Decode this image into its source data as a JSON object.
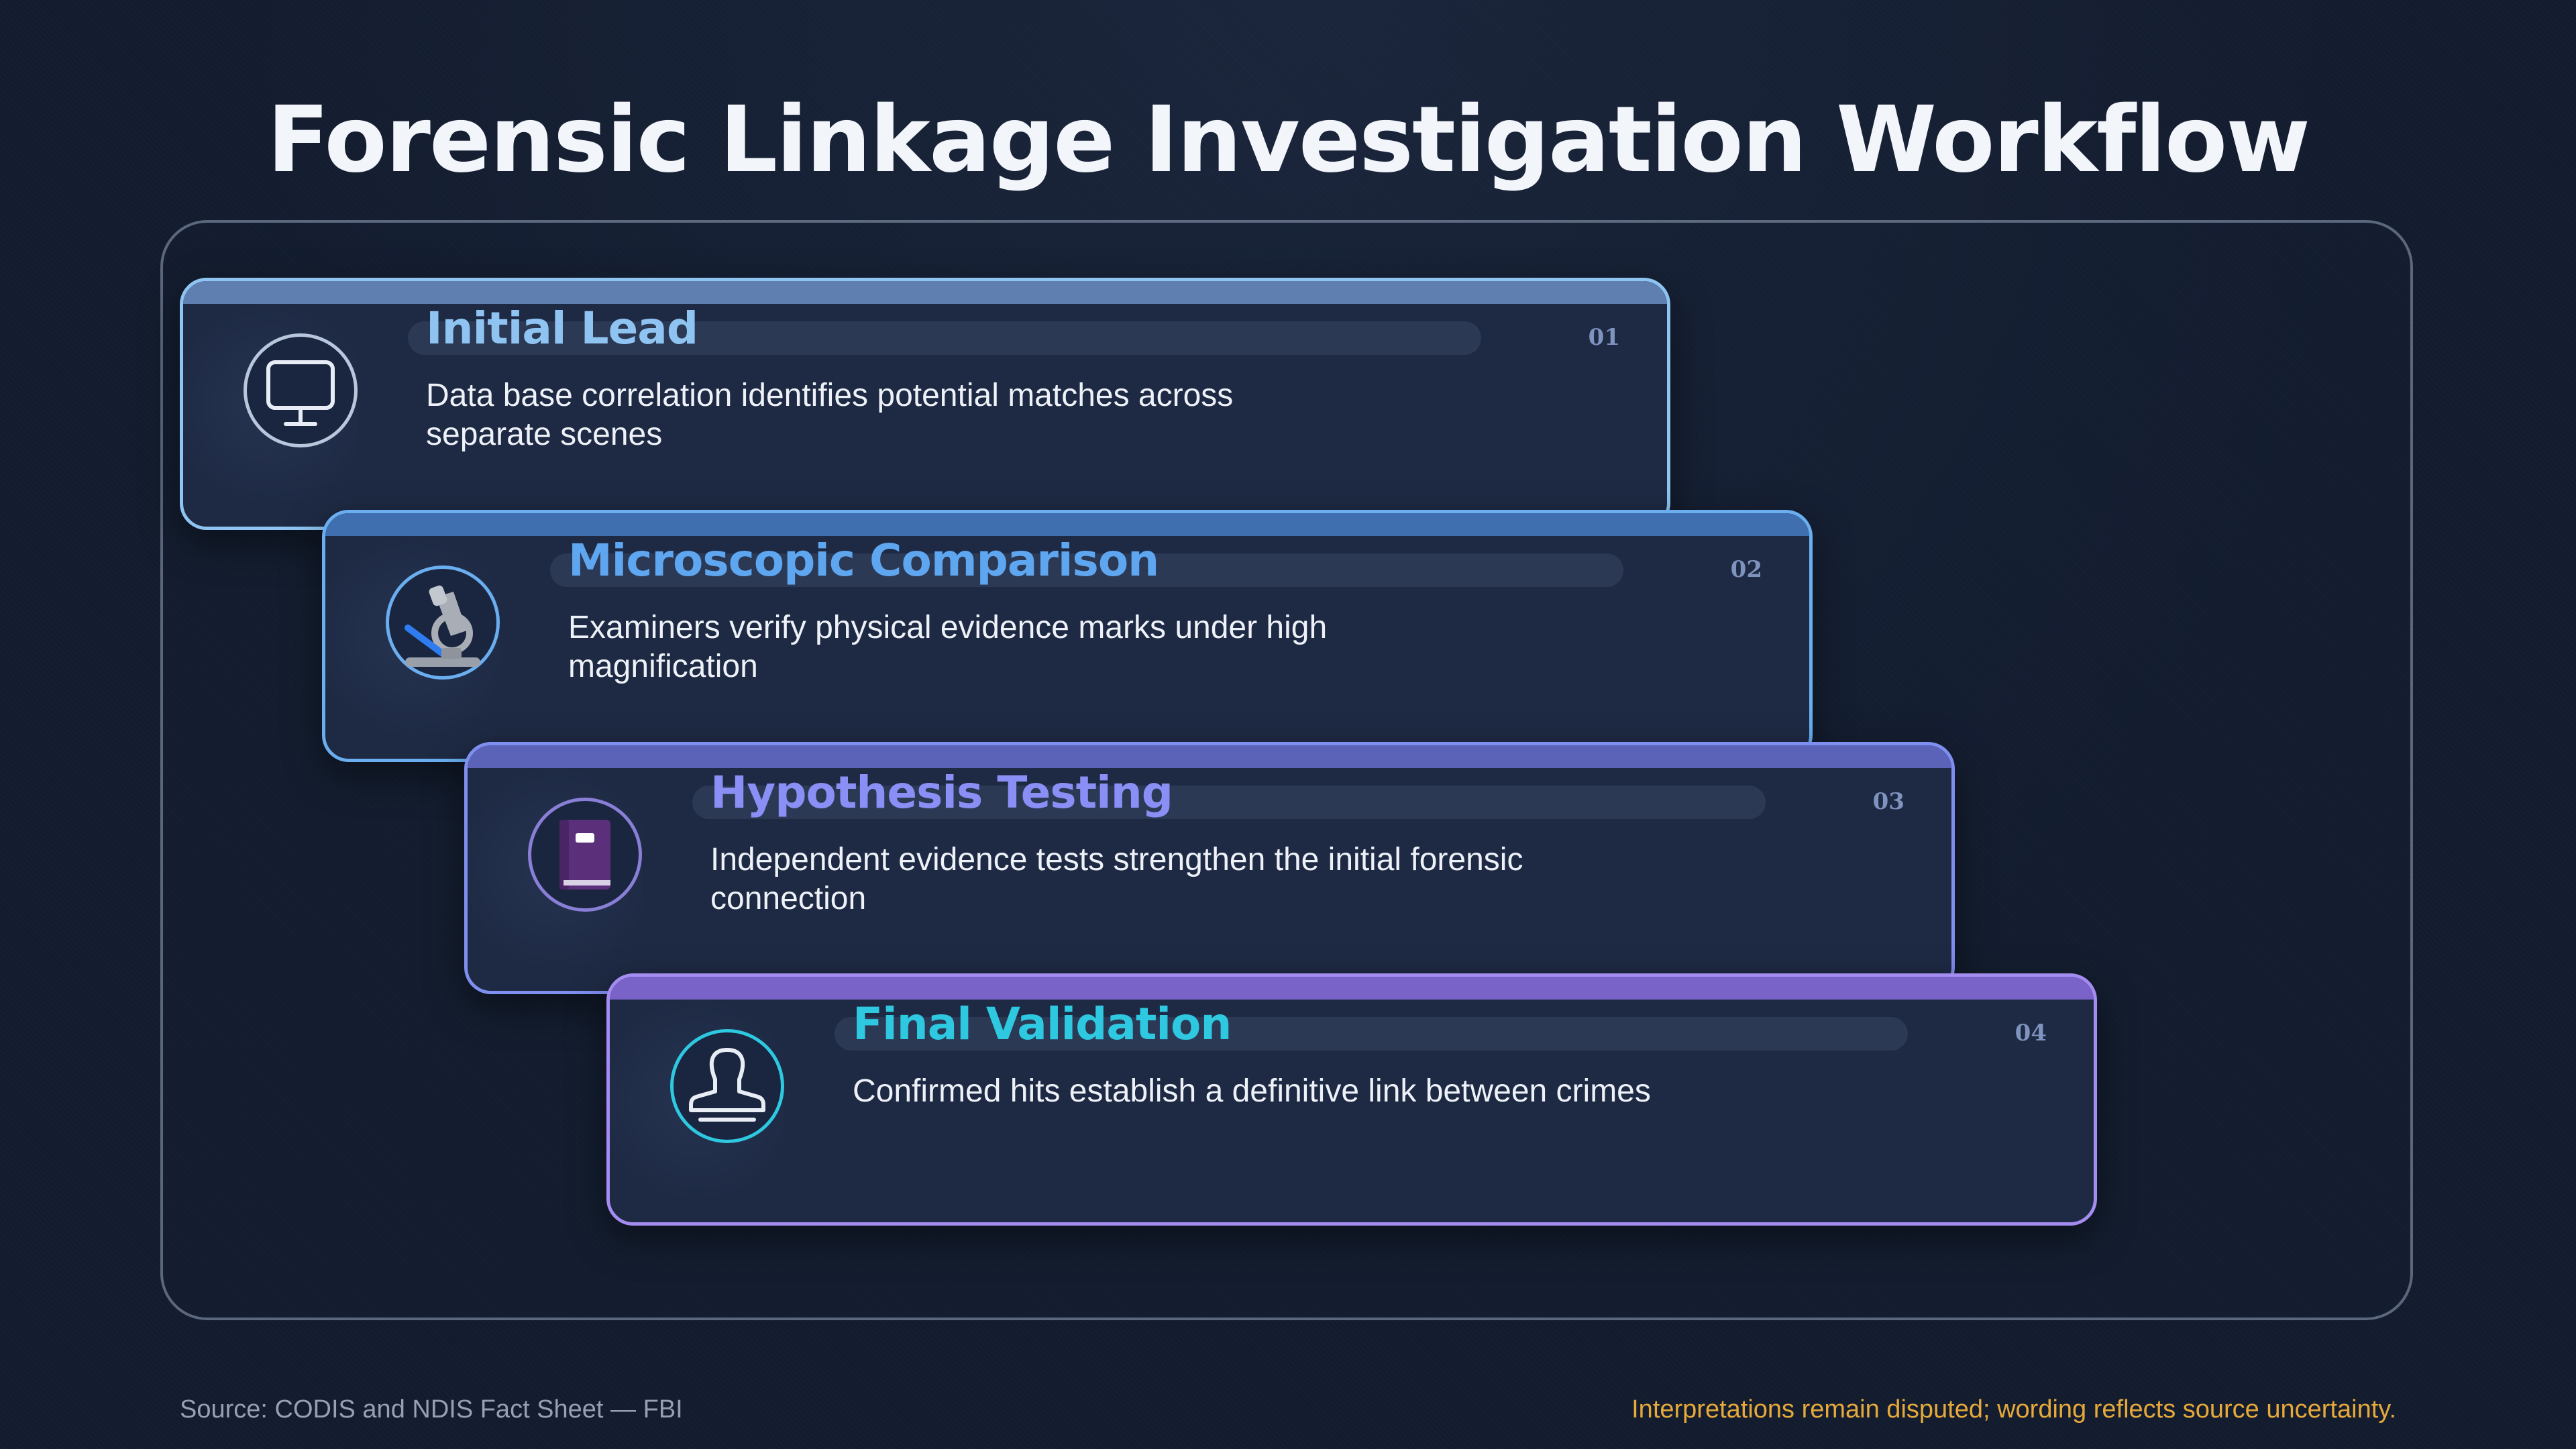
{
  "title": "Forensic Linkage Investigation Workflow",
  "steps": [
    {
      "number": "01",
      "title": "Initial Lead",
      "description": "Data base correlation identifies potential matches across separate scenes",
      "icon": "monitor-icon",
      "accent": "#8fc4f2"
    },
    {
      "number": "02",
      "title": "Microscopic Comparison",
      "description": "Examiners verify physical evidence marks under high magnification",
      "icon": "microscope-icon",
      "accent": "#5fa6f0"
    },
    {
      "number": "03",
      "title": "Hypothesis Testing",
      "description": "Independent evidence tests strengthen the initial forensic connection",
      "icon": "book-icon",
      "accent": "#8a8ff5"
    },
    {
      "number": "04",
      "title": "Final Validation",
      "description": "Confirmed hits establish a definitive link between crimes",
      "icon": "stamp-icon",
      "accent": "#2ec8e0"
    }
  ],
  "footer": {
    "source": "Source: CODIS and NDIS Fact Sheet — FBI",
    "note": "Interpretations remain disputed; wording reflects source uncertainty."
  },
  "colors": {
    "background": "#131c2e",
    "card": "#1e2a44",
    "note": "#e6a93a"
  }
}
